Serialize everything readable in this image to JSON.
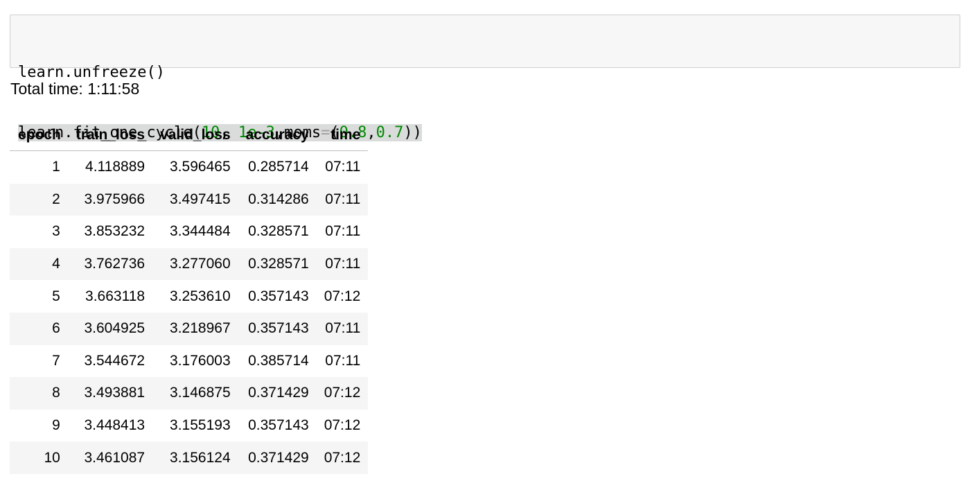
{
  "code_cell": {
    "line1": {
      "obj": "learn",
      "dot": ".",
      "method": "unfreeze",
      "args": "()"
    },
    "line2": {
      "obj": "learn",
      "dot": ".",
      "method": "fit_one_cycle",
      "open_paren": "(",
      "arg1": "10",
      "sep1": ", ",
      "arg2": "1e-3",
      "sep2": ",",
      "kwarg_name": "moms",
      "eq": "=",
      "open_tuple": "(",
      "t1": "0.8",
      "t_sep": ",",
      "t2": "0.7",
      "close": "))"
    }
  },
  "output": {
    "total_time": "Total time: 1:11:58"
  },
  "table": {
    "headers": [
      "epoch",
      "train_loss",
      "valid_loss",
      "accuracy",
      "time"
    ],
    "rows": [
      [
        "1",
        "4.118889",
        "3.596465",
        "0.285714",
        "07:11"
      ],
      [
        "2",
        "3.975966",
        "3.497415",
        "0.314286",
        "07:11"
      ],
      [
        "3",
        "3.853232",
        "3.344484",
        "0.328571",
        "07:11"
      ],
      [
        "4",
        "3.762736",
        "3.277060",
        "0.328571",
        "07:11"
      ],
      [
        "5",
        "3.663118",
        "3.253610",
        "0.357143",
        "07:12"
      ],
      [
        "6",
        "3.604925",
        "3.218967",
        "0.357143",
        "07:11"
      ],
      [
        "7",
        "3.544672",
        "3.176003",
        "0.385714",
        "07:11"
      ],
      [
        "8",
        "3.493881",
        "3.146875",
        "0.371429",
        "07:12"
      ],
      [
        "9",
        "3.448413",
        "3.155193",
        "0.357143",
        "07:12"
      ],
      [
        "10",
        "3.461087",
        "3.156124",
        "0.371429",
        "07:12"
      ]
    ]
  },
  "colors": {
    "number": "#008800",
    "operator": "#a0a0a0",
    "cell_background": "#f7f7f7",
    "selection": "#d9dcdb",
    "row_stripe": "#f5f5f5"
  }
}
